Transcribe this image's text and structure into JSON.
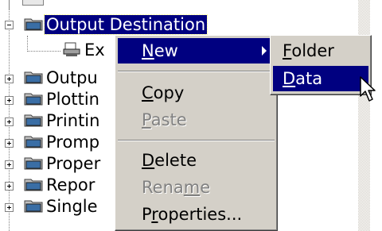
{
  "tree": {
    "items": [
      {
        "label": "Output Destination",
        "selected": true,
        "expander": "minus"
      },
      {
        "label": "Ex"
      },
      {
        "label": "Outpu",
        "expander": "plus"
      },
      {
        "label": "Plottin",
        "expander": "plus"
      },
      {
        "label": "Printin",
        "expander": "plus"
      },
      {
        "label": "Promp",
        "expander": "plus"
      },
      {
        "label": "Proper",
        "expander": "plus"
      },
      {
        "label": "Repor",
        "expander": "plus"
      },
      {
        "label": "Single",
        "expander": "plus"
      }
    ]
  },
  "context_menu": {
    "new": {
      "pre": "",
      "u": "N",
      "post": "ew"
    },
    "copy": {
      "pre": "",
      "u": "C",
      "post": "opy"
    },
    "paste": {
      "pre": "",
      "u": "P",
      "post": "aste"
    },
    "delete": {
      "pre": "",
      "u": "D",
      "post": "elete"
    },
    "rename": {
      "pre": "Rena",
      "u": "m",
      "post": "e"
    },
    "properties": {
      "pre": "P",
      "u": "r",
      "post": "operties..."
    }
  },
  "submenu": {
    "folder": {
      "pre": "",
      "u": "F",
      "post": "older"
    },
    "data": {
      "pre": "",
      "u": "D",
      "post": "ata"
    }
  },
  "colors": {
    "highlight": "#000080",
    "menu_bg": "#d4d0c8",
    "disabled": "#808080"
  }
}
